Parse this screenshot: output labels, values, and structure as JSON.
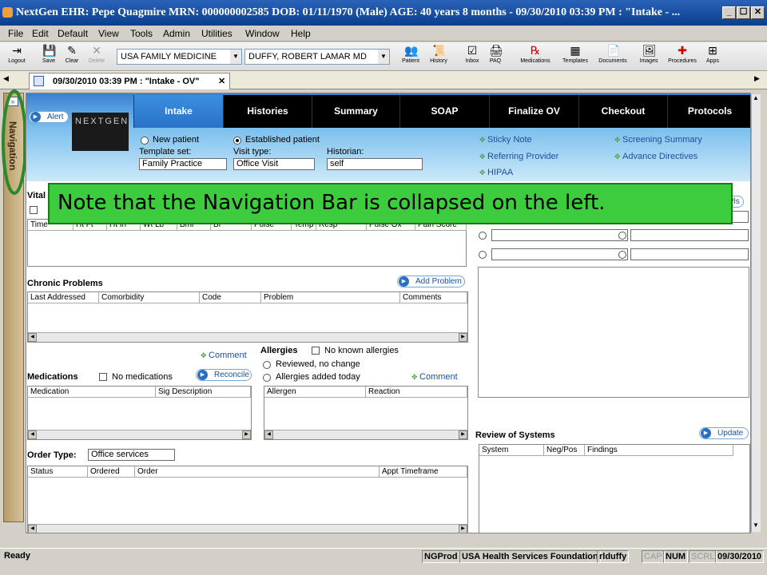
{
  "window": {
    "title": "NextGen EHR: Pepe Quagmire  MRN: 000000002585  DOB: 01/11/1970  (Male)  AGE: 40 years 8 months - 09/30/2010 03:39 PM : \"Intake - ...",
    "min": "_",
    "max": "☐",
    "close": "✕"
  },
  "menu": [
    "File",
    "Edit",
    "Default",
    "View",
    "Tools",
    "Admin",
    "Utilities",
    "Window",
    "Help"
  ],
  "toolbar": {
    "left": [
      {
        "label": "Logout",
        "icon": "logout-icon",
        "glyph": "⇥"
      },
      {
        "label": "Save",
        "icon": "save-icon",
        "glyph": "💾"
      },
      {
        "label": "Clear",
        "icon": "clear-icon",
        "glyph": "✎"
      },
      {
        "label": "Delete",
        "icon": "delete-icon",
        "glyph": "✕"
      }
    ],
    "practice": "USA FAMILY MEDICINE",
    "provider": "DUFFY, ROBERT  LAMAR MD",
    "right": [
      {
        "label": "Patient",
        "icon": "patient-icon",
        "glyph": "👥"
      },
      {
        "label": "History",
        "icon": "history-icon",
        "glyph": "📜"
      },
      {
        "label": "Inbox",
        "icon": "inbox-icon",
        "glyph": "☑"
      },
      {
        "label": "PAQ",
        "icon": "paq-icon",
        "glyph": "🖨"
      },
      {
        "label": "Medications",
        "icon": "medications-icon",
        "glyph": "℞"
      },
      {
        "label": "Templates",
        "icon": "templates-icon",
        "glyph": "▦"
      },
      {
        "label": "Documents",
        "icon": "documents-icon",
        "glyph": "📄"
      },
      {
        "label": "Images",
        "icon": "images-icon",
        "glyph": "🖼"
      },
      {
        "label": "Procedures",
        "icon": "procedures-icon",
        "glyph": "✚"
      },
      {
        "label": "Apps",
        "icon": "apps-icon",
        "glyph": "⊞"
      }
    ]
  },
  "doc_tab": "09/30/2010 03:39 PM : \"Intake - OV\"",
  "navigation_label": "Navigation",
  "alert_label": "Alert",
  "logo_text": "NEXTGEN",
  "tabs": [
    "Intake",
    "Histories",
    "Summary",
    "SOAP",
    "Finalize OV",
    "Checkout",
    "Protocols"
  ],
  "active_tab": "Intake",
  "header": {
    "new_patient": "New patient",
    "established_patient": "Established patient",
    "template_set_label": "Template set:",
    "template_set": "Family Practice",
    "visit_type_label": "Visit type:",
    "visit_type": "Office Visit",
    "historian_label": "Historian:",
    "historian": "self",
    "links": [
      "Sticky Note",
      "Referring Provider",
      "HIPAA",
      "Screening Summary",
      "Advance Directives"
    ]
  },
  "vitals": {
    "label": "Vital",
    "columns": [
      "Time",
      "Ht Ft",
      "Ht In",
      "Wt Lb",
      "Bmi",
      "Bf",
      "Pulse",
      "Temp F",
      "Resp",
      "Pulse Ox",
      "Pain Score"
    ],
    "all_pls": "All Pls"
  },
  "chronic": {
    "label": "Chronic Problems",
    "add": "Add Problem",
    "columns": [
      "Last Addressed",
      "Comorbidity",
      "Code",
      "Problem",
      "Comments"
    ]
  },
  "medications": {
    "label": "Medications",
    "none": "No medications",
    "comment": "Comment",
    "reconcile": "Reconcile",
    "columns": [
      "Medication",
      "Sig Description"
    ]
  },
  "allergies": {
    "label": "Allergies",
    "none": "No known allergies",
    "reviewed": "Reviewed, no change",
    "added": "Allergies added today",
    "comment": "Comment",
    "columns": [
      "Allergen",
      "Reaction"
    ]
  },
  "orders": {
    "label": "Order Type:",
    "type": "Office services",
    "columns": [
      "Status",
      "Ordered",
      "Order",
      "Appt Timeframe"
    ]
  },
  "ros": {
    "label": "Review of Systems",
    "update": "Update",
    "columns": [
      "System",
      "Neg/Pos",
      "Findings"
    ]
  },
  "callout": "Note that the Navigation Bar is collapsed on the left.",
  "status": {
    "ready": "Ready",
    "db": "NGProd",
    "org": "USA Health Services Foundation",
    "user": "rlduffy",
    "cap": "CAP",
    "num": "NUM",
    "scrl": "SCRL",
    "date": "09/30/2010"
  }
}
